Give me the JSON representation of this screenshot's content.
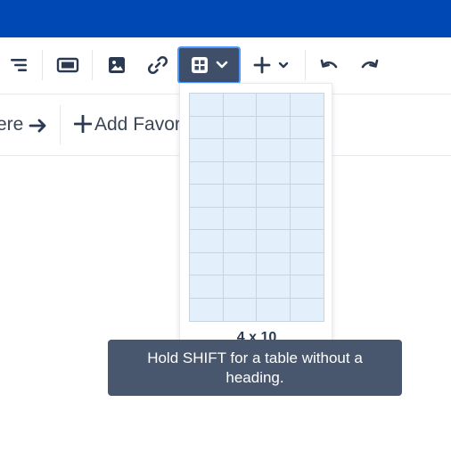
{
  "toolbar": {
    "buttons": [
      {
        "icon": "align-menu-icon"
      },
      {
        "icon": "panel-icon"
      },
      {
        "icon": "image-icon"
      },
      {
        "icon": "link-icon"
      },
      {
        "icon": "table-icon",
        "active": true
      },
      {
        "icon": "plus-icon"
      },
      {
        "icon": "undo-icon"
      },
      {
        "icon": "redo-icon"
      }
    ]
  },
  "favorites": {
    "left_text": "ere",
    "add_label": "Add Favor"
  },
  "table_picker": {
    "columns": 4,
    "rows": 10,
    "size_label": "4 x 10"
  },
  "tooltip": {
    "text": "Hold SHIFT for a table without a heading."
  },
  "colors": {
    "topbar": "#0048b3",
    "active_button": "#3f4f6a",
    "focus_ring": "#4c9aff",
    "grid_cell": "#e3f0fc",
    "tooltip_bg": "#48566e"
  }
}
